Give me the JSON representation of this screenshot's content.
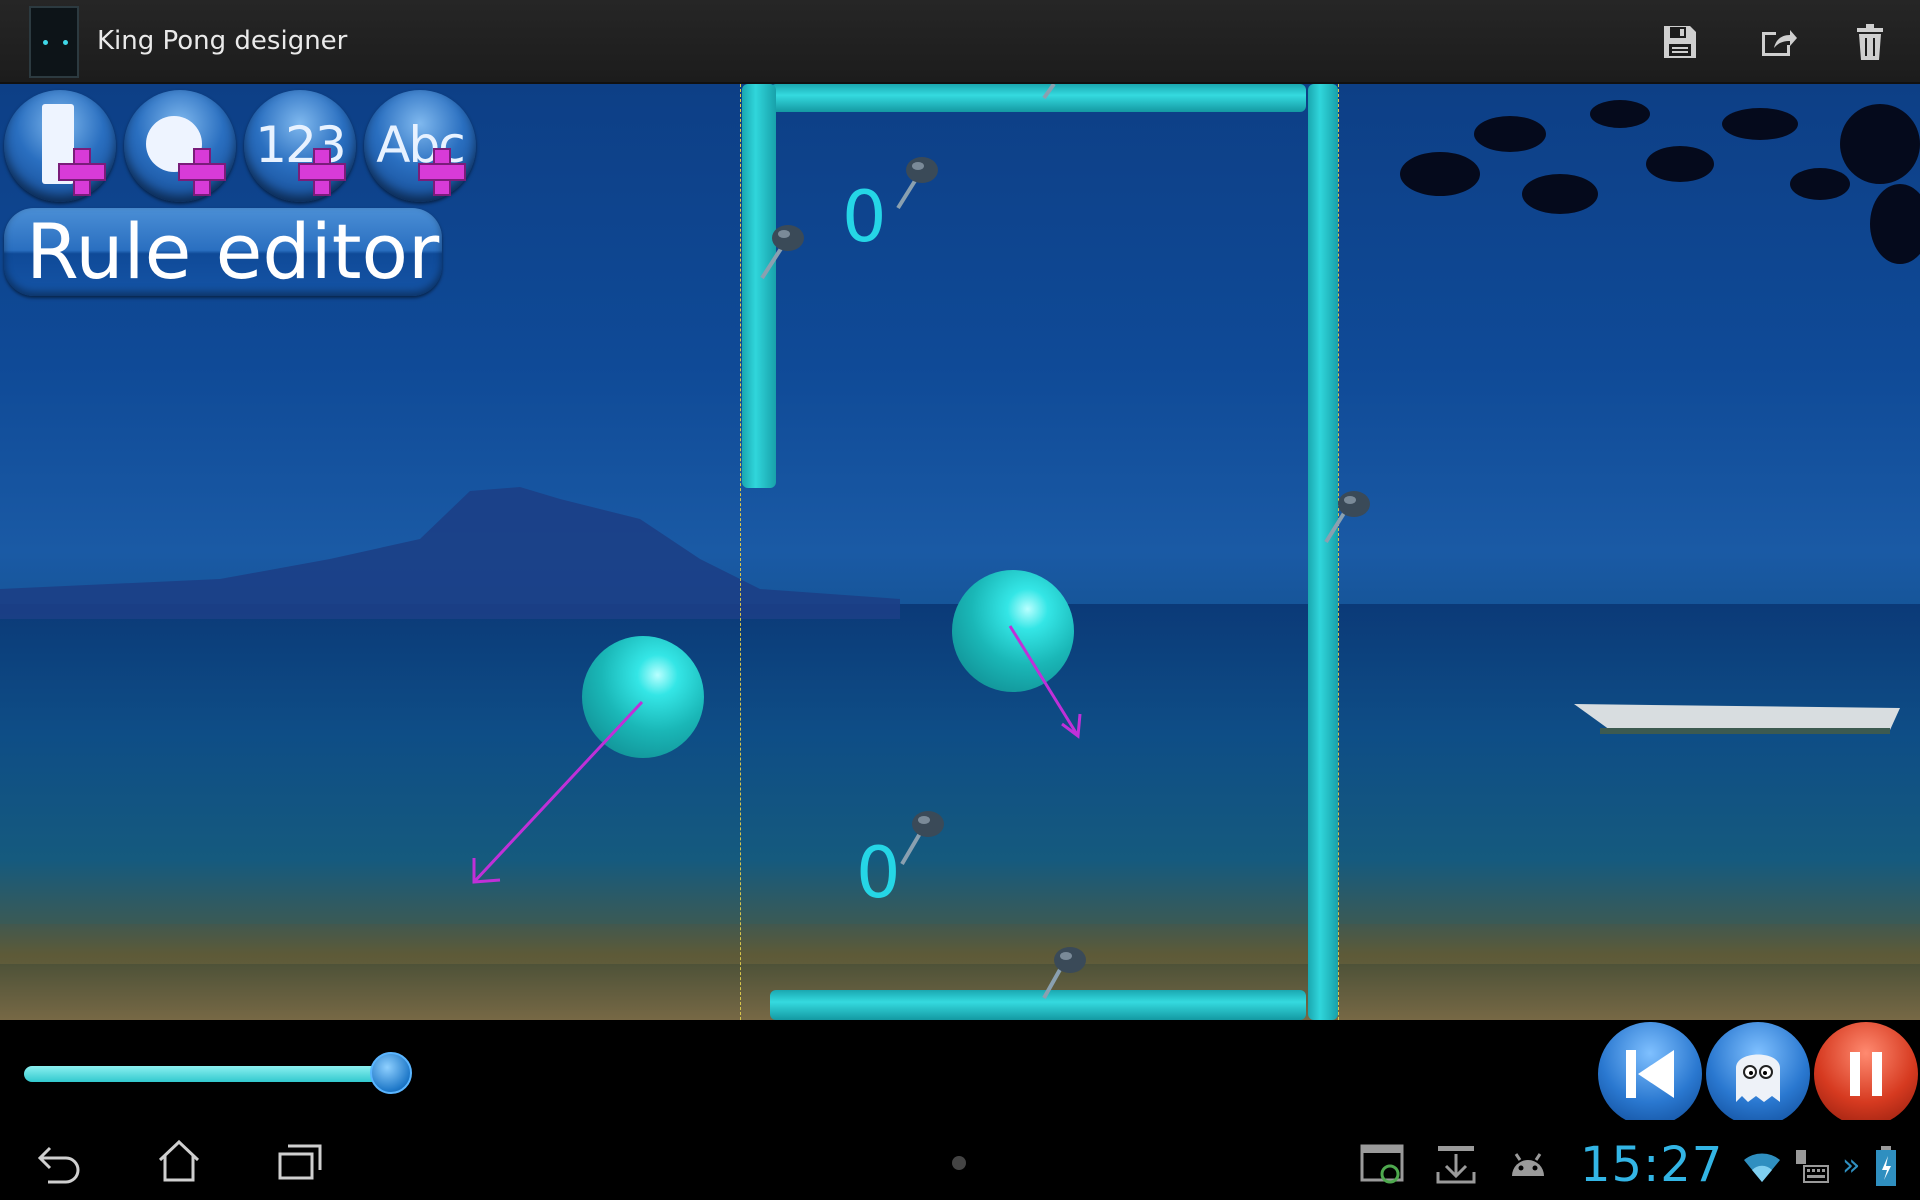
{
  "app": {
    "title": "King Pong designer",
    "actions": [
      {
        "name": "save",
        "icon": "save-icon"
      },
      {
        "name": "share",
        "icon": "share-icon"
      },
      {
        "name": "delete",
        "icon": "trash-icon"
      }
    ]
  },
  "toolbar": {
    "add_wall_icon": "add-wall-icon",
    "add_ball_icon": "add-ball-icon",
    "add_number_label": "123",
    "add_text_label": "Abc",
    "rule_editor_label": "Rule editor"
  },
  "game": {
    "score_top": "0",
    "score_bottom": "0",
    "accent_color": "#2ad0d8",
    "velocity_arrow_color": "#c030d8"
  },
  "controls": {
    "speed_slider_level": 0.95,
    "buttons": [
      "rewind-icon",
      "ghost-icon",
      "pause-icon"
    ]
  },
  "system": {
    "clock": "15:27",
    "nav": [
      "back-icon",
      "home-icon",
      "recent-apps-icon"
    ],
    "status": [
      "screenshot-icon",
      "download-icon",
      "android-icon",
      "wifi-icon",
      "keyboard-icon",
      "battery-icon"
    ]
  }
}
